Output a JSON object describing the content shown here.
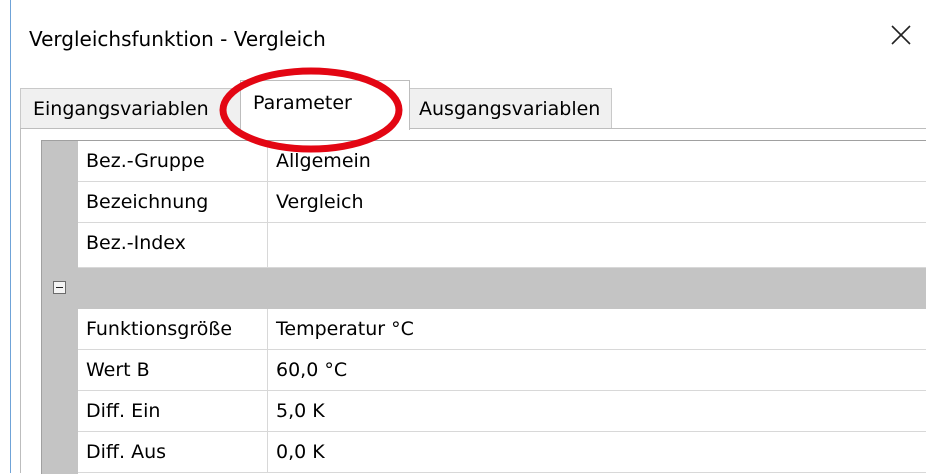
{
  "window": {
    "title": "Vergleichsfunktion - Vergleich",
    "close_icon": "close-icon"
  },
  "tabs": [
    {
      "label": "Eingangsvariablen",
      "active": false
    },
    {
      "label": "Parameter",
      "active": true
    },
    {
      "label": "Ausgangsvariablen",
      "active": false
    }
  ],
  "rows_top": [
    {
      "label": "Bez.-Gruppe",
      "value": "Allgemein"
    },
    {
      "label": "Bezeichnung",
      "value": "Vergleich"
    },
    {
      "label": "Bez.-Index",
      "value": ""
    }
  ],
  "section": {
    "collapse_icon": "collapse-minus-icon",
    "expanded": true
  },
  "rows_bottom": [
    {
      "label": "Funktionsgröße",
      "value": "Temperatur °C"
    },
    {
      "label": "Wert B",
      "value": "60,0 °C"
    },
    {
      "label": "Diff. Ein",
      "value": "5,0 K"
    },
    {
      "label": "Diff. Aus",
      "value": "0,0 K"
    }
  ],
  "colors": {
    "highlight_ring": "#e30613",
    "gutter": "#c4c4c4",
    "window_border": "#6fa3d8"
  }
}
